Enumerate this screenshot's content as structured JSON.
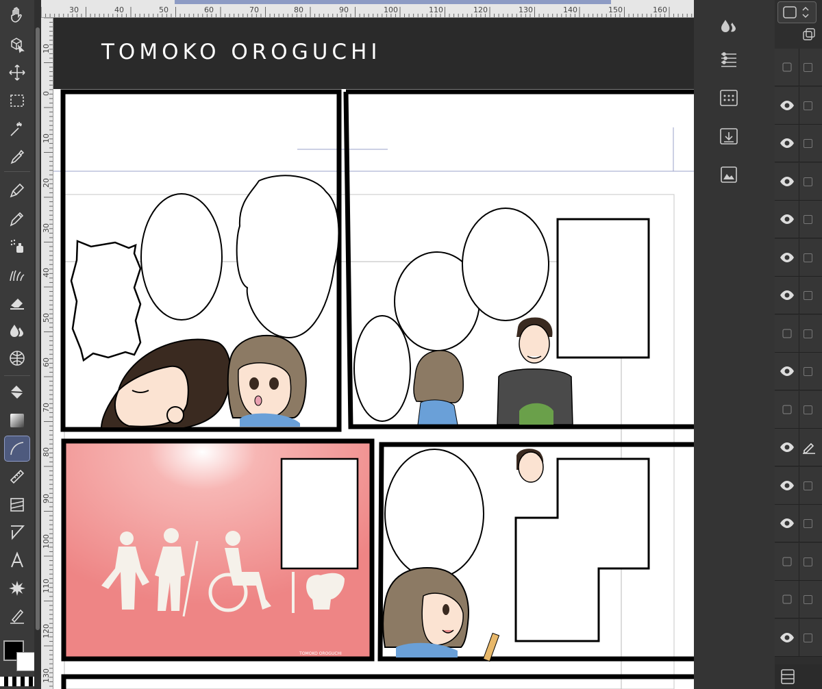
{
  "app": {
    "canvas_header": {
      "title": "TOMOKO OROGUCHI"
    },
    "watermark": "TOMOKO OROGUCHI"
  },
  "rulers": {
    "top_labels": [
      "30",
      "40",
      "50",
      "60",
      "70",
      "80",
      "90",
      "100",
      "110",
      "120",
      "130",
      "140",
      "150",
      "160"
    ],
    "left_labels": [
      "10",
      "0",
      "10",
      "20",
      "30",
      "40",
      "50",
      "60",
      "70",
      "80",
      "90",
      "100",
      "110",
      "120",
      "130"
    ]
  },
  "toolbar": {
    "tools": [
      "hand-icon",
      "object-icon",
      "move-icon",
      "selection-icon",
      "magic-wand-icon",
      "eyedropper-icon",
      "pen-icon",
      "pencil-icon",
      "airbrush-icon",
      "decoration-icon",
      "eraser-icon",
      "blend-icon",
      "grid-icon",
      "fill-icon",
      "gradient-icon",
      "figure-icon",
      "ruler-icon",
      "frame-border-icon",
      "balloon-icon",
      "text-icon",
      "burst-icon",
      "correct-line-icon"
    ],
    "active_tool": "figure-icon"
  },
  "right_panel": {
    "icons": [
      "tool-property-icon",
      "brush-size-icon",
      "sub-tool-icon",
      "material-icon",
      "import-icon",
      "navigator-icon"
    ]
  },
  "layers": {
    "rows": [
      {
        "visible": false,
        "editing": false
      },
      {
        "visible": true,
        "editing": false
      },
      {
        "visible": true,
        "editing": false
      },
      {
        "visible": true,
        "editing": false
      },
      {
        "visible": true,
        "editing": false
      },
      {
        "visible": true,
        "editing": false
      },
      {
        "visible": true,
        "editing": false
      },
      {
        "visible": false,
        "editing": false
      },
      {
        "visible": true,
        "editing": false
      },
      {
        "visible": false,
        "editing": false
      },
      {
        "visible": true,
        "editing": true
      },
      {
        "visible": true,
        "editing": false
      },
      {
        "visible": true,
        "editing": false
      },
      {
        "visible": false,
        "editing": false
      },
      {
        "visible": false,
        "editing": false
      },
      {
        "visible": true,
        "editing": false
      }
    ]
  },
  "colors": {
    "main": "#000000",
    "sub": "#ffffff",
    "panel_bg": "#343434",
    "accent": "#8d9bc4",
    "pink_panel": "#f08a8a"
  }
}
